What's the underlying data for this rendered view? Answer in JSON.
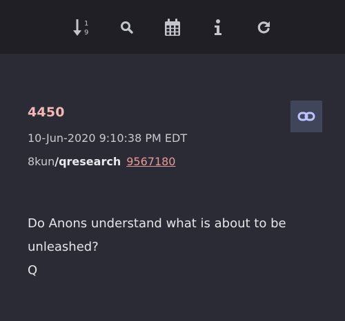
{
  "toolbar": {
    "buttons": [
      {
        "icon": "sort-numeric-icon",
        "label": "sort"
      },
      {
        "icon": "search-icon",
        "label": "search"
      },
      {
        "icon": "calendar-icon",
        "label": "calendar"
      },
      {
        "icon": "info-icon",
        "label": "info"
      },
      {
        "icon": "refresh-icon",
        "label": "refresh"
      }
    ]
  },
  "post": {
    "number": "4450",
    "timestamp": "10-Jun-2020 9:10:38 PM EDT",
    "site": "8kun",
    "board": "/qresearch",
    "ref_id": "9567180",
    "body_lines": [
      "Do Anons understand what is about to be",
      "unleashed?",
      "Q"
    ]
  },
  "colors": {
    "background": "#2b2b35",
    "toolbar": "#1f1f25",
    "icon": "#c4c4cc",
    "post_number": "#f3b7b7",
    "link": "#e89a9a",
    "link_button_bg": "#41455a",
    "link_icon": "#bcc2ff"
  }
}
